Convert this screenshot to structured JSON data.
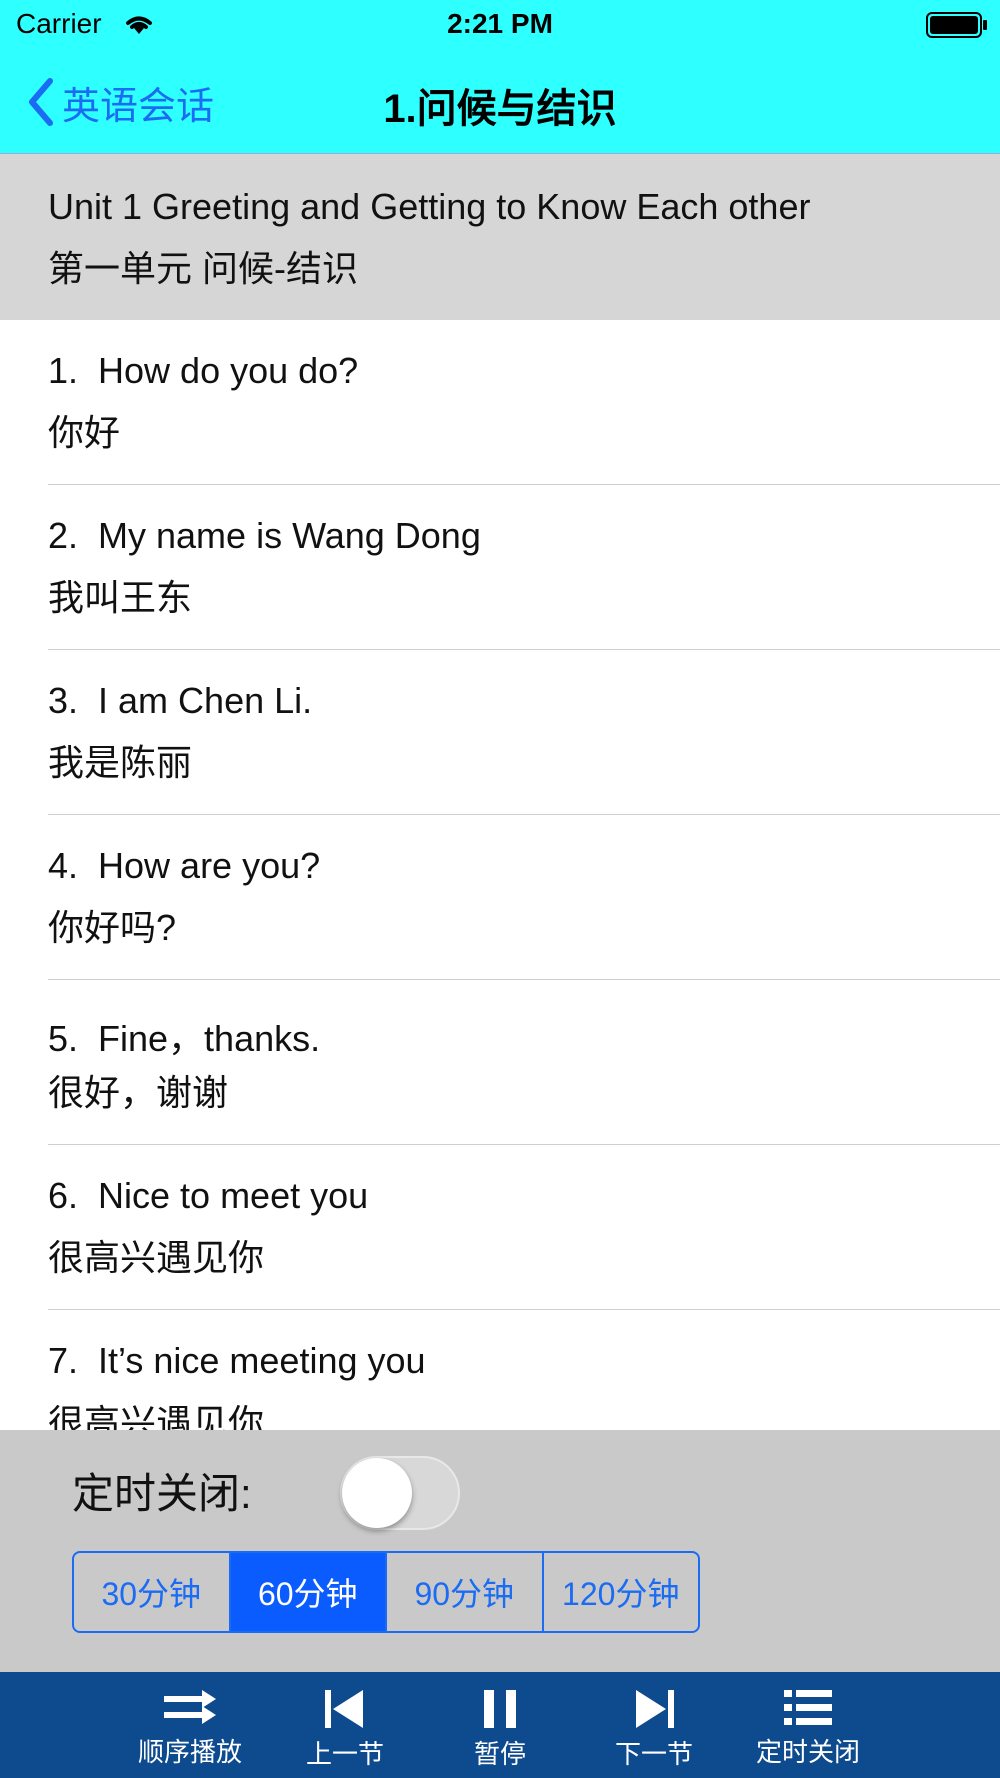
{
  "status": {
    "carrier": "Carrier",
    "time": "2:21 PM"
  },
  "nav": {
    "back_label": "英语会话",
    "title": "1.问候与结识"
  },
  "unit": {
    "en": "Unit 1  Greeting and Getting to Know Each other",
    "zh": "第一单元 问候-结识"
  },
  "items": [
    {
      "en": "1.  How do you do?",
      "zh": "你好"
    },
    {
      "en": "2.  My name is Wang Dong",
      "zh": "我叫王东"
    },
    {
      "en": "3.  I am Chen Li.",
      "zh": "我是陈丽"
    },
    {
      "en": "4.  How are you?",
      "zh": "你好吗?"
    },
    {
      "en": "5.  Fine，thanks.",
      "zh": "很好，谢谢"
    },
    {
      "en": "6.  Nice to meet you",
      "zh": "很高兴遇见你"
    },
    {
      "en": "7.  It’s nice meeting you",
      "zh": "很高兴遇见你"
    }
  ],
  "timer": {
    "label": "定时关闭:",
    "enabled": false,
    "options": [
      "30分钟",
      "60分钟",
      "90分钟",
      "120分钟"
    ],
    "selected": "60分钟"
  },
  "toolbar": {
    "order_label": "顺序播放",
    "prev_label": "上一节",
    "pause_label": "暂停",
    "next_label": "下一节",
    "timer_label": "定时关闭"
  },
  "colors": {
    "nav_bg": "#2effff",
    "accent": "#1b6cf2",
    "toolbar_bg": "#0e4a8e",
    "selected_segment": "#0a5cff"
  }
}
